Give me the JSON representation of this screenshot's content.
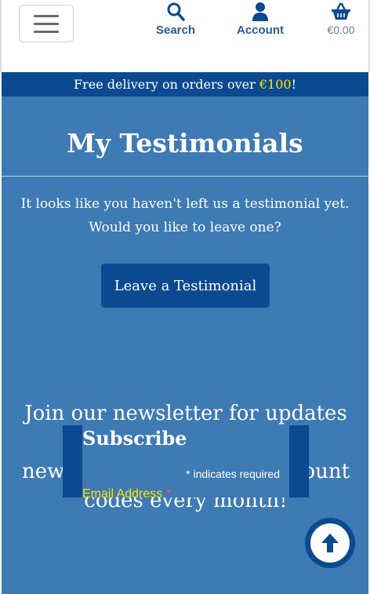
{
  "header": {
    "menu_icon": "hamburger-icon",
    "search": {
      "icon": "search-icon",
      "label": "Search"
    },
    "account": {
      "icon": "user-icon",
      "label": "Account"
    },
    "basket": {
      "icon": "basket-icon",
      "label": "€0.00"
    }
  },
  "banner": {
    "text_before": "Free delivery on orders over ",
    "highlight": "€100",
    "text_after": "!"
  },
  "main": {
    "title": "My Testimonials",
    "message_line1": "It looks like you haven't left us a testimonial yet.",
    "message_line2": "Would you like to leave one?",
    "cta_label": "Leave a Testimonial",
    "newsletter_line1": "Join our newsletter for updates on",
    "newsletter_line2": "new products and free discount",
    "newsletter_line3": "codes every month!"
  },
  "subscribe": {
    "title": "Subscribe",
    "required_marker": "*",
    "required_text": " indicates required",
    "email_label": "Email Address ",
    "email_marker": "*"
  },
  "back_to_top": {
    "icon": "arrow-up-icon"
  },
  "colors": {
    "brand_dark": "#0b4a91",
    "main_bg": "#3e7ab3",
    "highlight": "#ffe600",
    "nav_text": "#2a5c97"
  }
}
